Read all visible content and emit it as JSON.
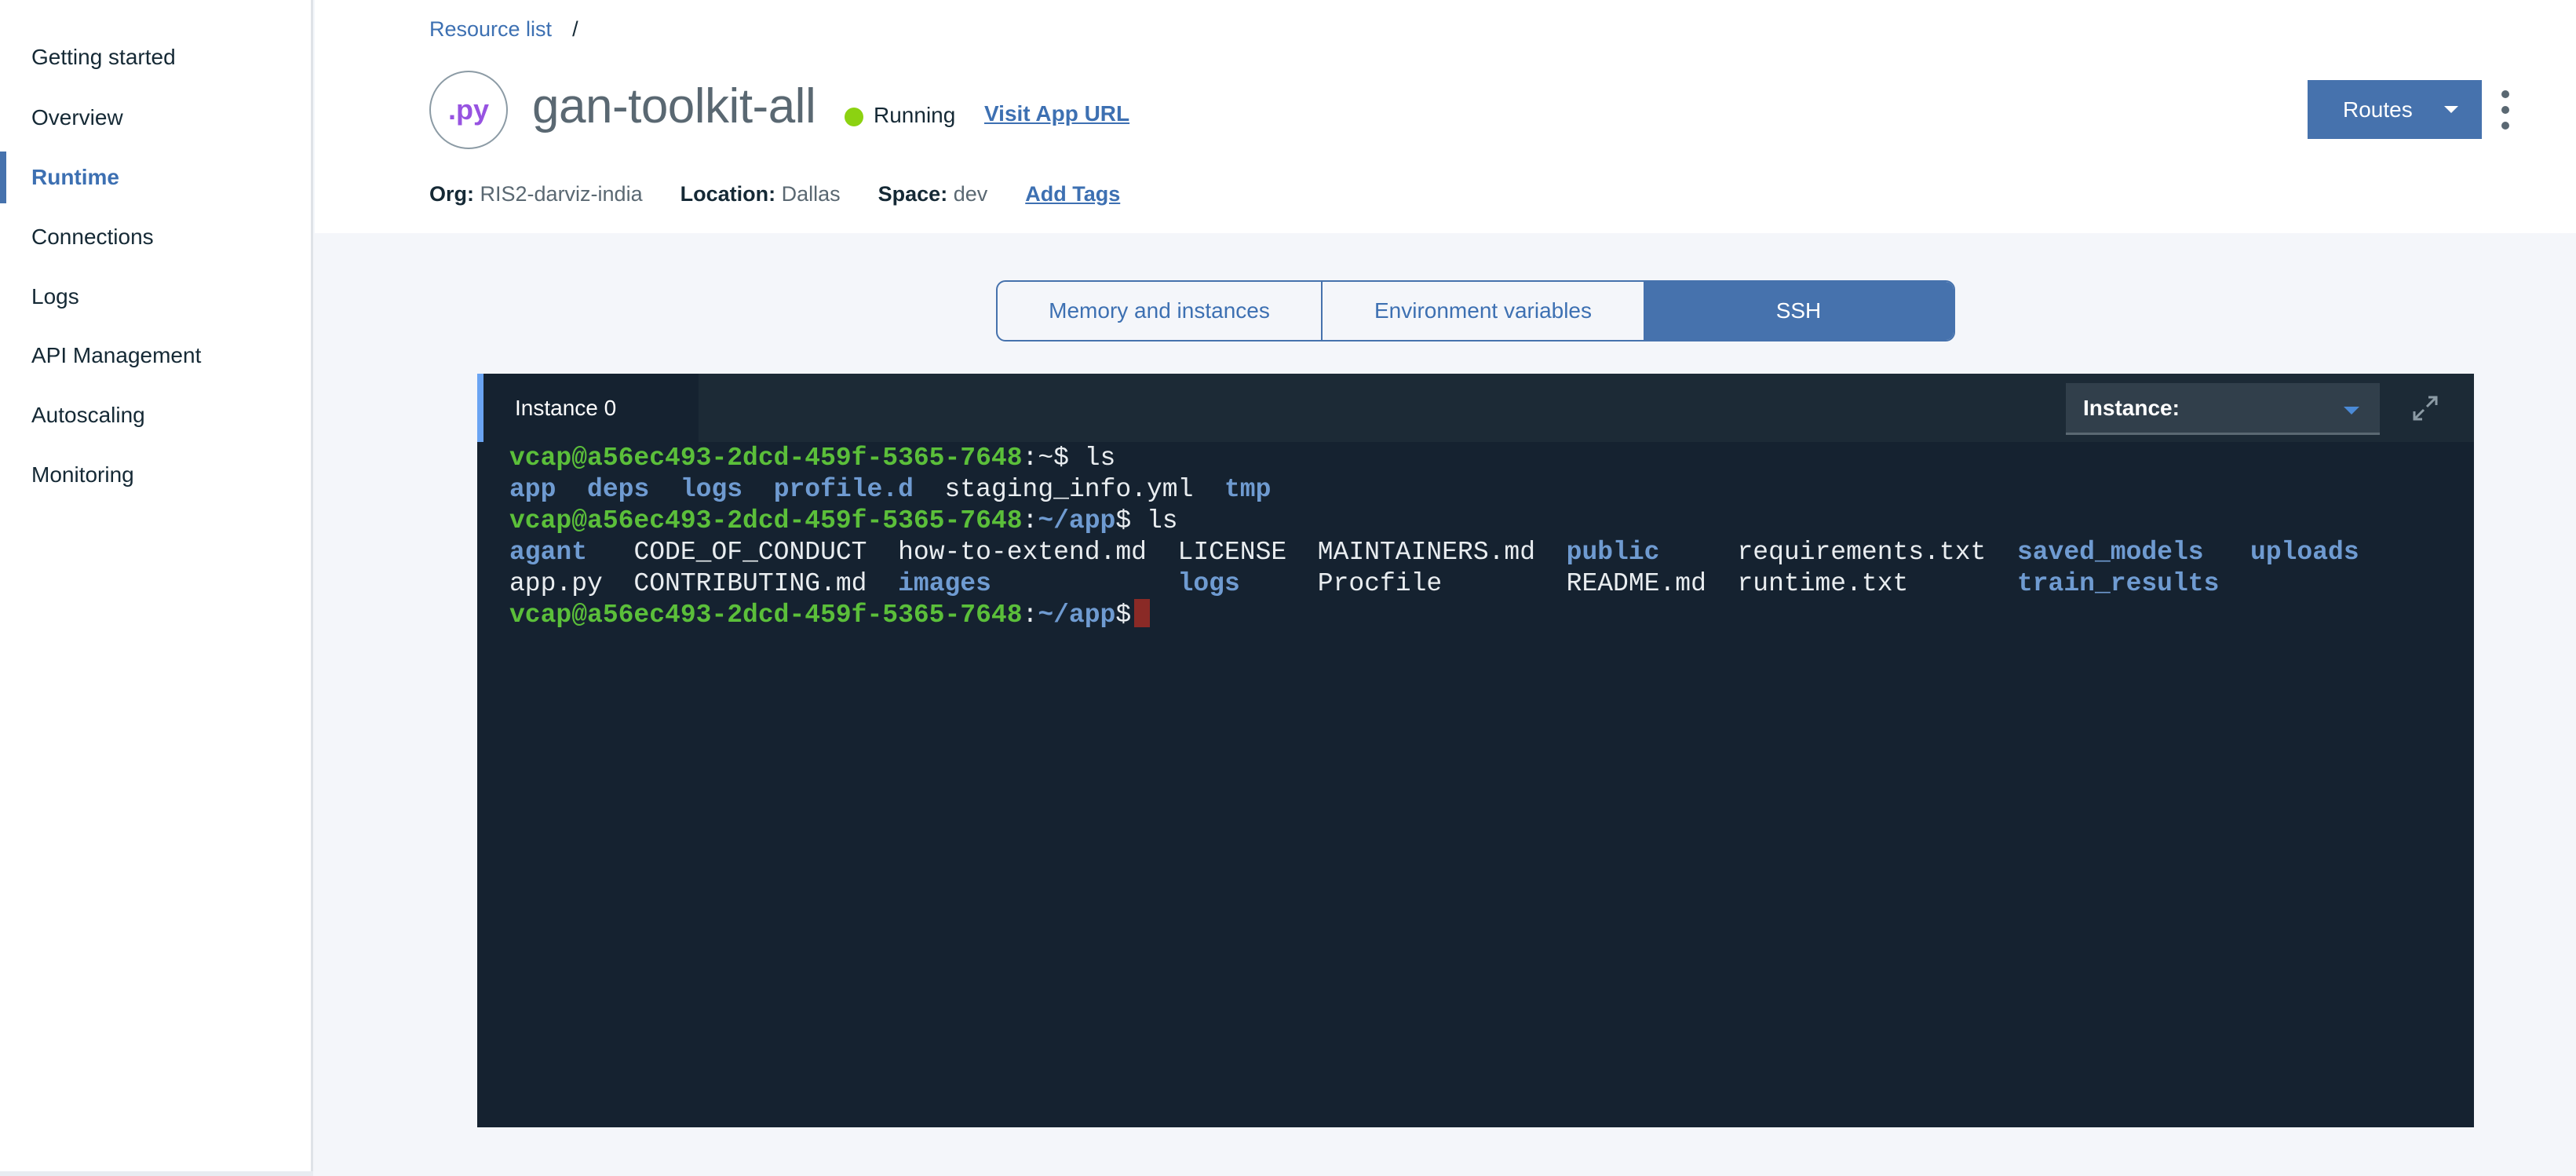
{
  "sidebar": {
    "items": [
      {
        "label": "Getting started",
        "active": false
      },
      {
        "label": "Overview",
        "active": false
      },
      {
        "label": "Runtime",
        "active": true
      },
      {
        "label": "Connections",
        "active": false
      },
      {
        "label": "Logs",
        "active": false
      },
      {
        "label": "API Management",
        "active": false
      },
      {
        "label": "Autoscaling",
        "active": false
      },
      {
        "label": "Monitoring",
        "active": false
      }
    ]
  },
  "header": {
    "breadcrumb": {
      "link": "Resource list",
      "separator": "/"
    },
    "app_icon_text": ".py",
    "title": "gan-toolkit-all",
    "status": {
      "label": "Running",
      "color": "#8cd211"
    },
    "visit_link": "Visit App URL",
    "meta": {
      "org_key": "Org:",
      "org_value": "RIS2-darviz-india",
      "location_key": "Location:",
      "location_value": "Dallas",
      "space_key": "Space:",
      "space_value": "dev",
      "add_tags": "Add Tags"
    },
    "routes_button": "Routes",
    "overflow_icon": "overflow-menu-vertical-icon"
  },
  "tabs": [
    {
      "label": "Memory and instances",
      "active": false
    },
    {
      "label": "Environment variables",
      "active": false
    },
    {
      "label": "SSH",
      "active": true
    }
  ],
  "terminal": {
    "instance_tab": "Instance 0",
    "instance_select_label": "Instance:",
    "expand_icon": "maximize-icon",
    "lines": [
      [
        {
          "t": "vcap@a56ec493-2dcd-459f-5365-7648",
          "c": "g"
        },
        {
          "t": ":~$ ls",
          "c": "w"
        }
      ],
      [
        {
          "t": "app",
          "c": "b"
        },
        {
          "t": "  ",
          "c": "w"
        },
        {
          "t": "deps",
          "c": "b"
        },
        {
          "t": "  ",
          "c": "w"
        },
        {
          "t": "logs",
          "c": "b"
        },
        {
          "t": "  ",
          "c": "w"
        },
        {
          "t": "profile.d",
          "c": "b"
        },
        {
          "t": "  staging_info.yml  ",
          "c": "w"
        },
        {
          "t": "tmp",
          "c": "b"
        }
      ],
      [
        {
          "t": "vcap@a56ec493-2dcd-459f-5365-7648",
          "c": "g"
        },
        {
          "t": ":",
          "c": "w"
        },
        {
          "t": "~/app",
          "c": "b"
        },
        {
          "t": "$ ls",
          "c": "w"
        }
      ],
      [
        {
          "t": "agant",
          "c": "b"
        },
        {
          "t": "   CODE_OF_CONDUCT  how-to-extend.md  LICENSE  MAINTAINERS.md  ",
          "c": "w"
        },
        {
          "t": "public",
          "c": "b"
        },
        {
          "t": "     requirements.txt  ",
          "c": "w"
        },
        {
          "t": "saved_models",
          "c": "b"
        },
        {
          "t": "   ",
          "c": "w"
        },
        {
          "t": "uploads",
          "c": "b"
        }
      ],
      [
        {
          "t": "app.py  CONTRIBUTING.md  ",
          "c": "w"
        },
        {
          "t": "images",
          "c": "b"
        },
        {
          "t": "            ",
          "c": "w"
        },
        {
          "t": "logs",
          "c": "b"
        },
        {
          "t": "     Procfile        README.md  runtime.txt       ",
          "c": "w"
        },
        {
          "t": "train_results",
          "c": "b"
        }
      ],
      [
        {
          "t": "vcap@a56ec493-2dcd-459f-5365-7648",
          "c": "g"
        },
        {
          "t": ":",
          "c": "w"
        },
        {
          "t": "~/app",
          "c": "b"
        },
        {
          "t": "$",
          "c": "w"
        }
      ]
    ],
    "cursor_color": "#8a2a26"
  },
  "colors": {
    "accent": "#4672ad",
    "link": "#3d70b2",
    "terminal_bg": "#152230",
    "prompt_green": "#5bbf3a",
    "dir_blue": "#6f9bd1"
  }
}
